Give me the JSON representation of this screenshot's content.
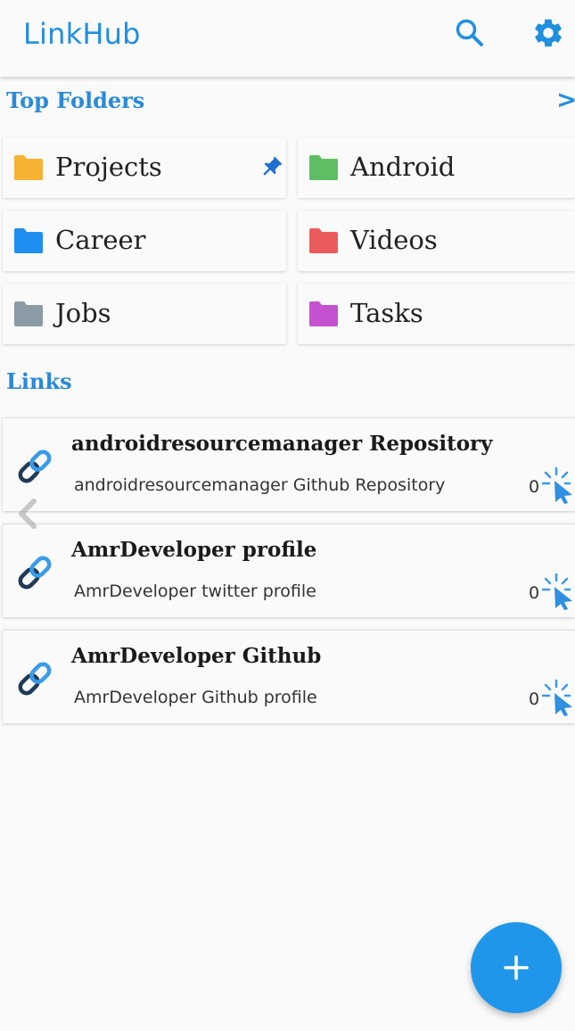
{
  "app_bar": {
    "title": "LinkHub",
    "icons": {
      "search": "search-icon",
      "settings": "gear-icon"
    }
  },
  "top_folders": {
    "title": "Top Folders",
    "more_icon": "chevron-right-icon",
    "items": [
      {
        "label": "Projects",
        "color": "#f5b233",
        "pinned": true
      },
      {
        "label": "Android",
        "color": "#5fbe63"
      },
      {
        "label": "Career",
        "color": "#1e8ff0"
      },
      {
        "label": "Videos",
        "color": "#ec5b5b"
      },
      {
        "label": "Jobs",
        "color": "#8a9ba6"
      },
      {
        "label": "Tasks",
        "color": "#c451cf"
      }
    ]
  },
  "links": {
    "title": "Links",
    "items": [
      {
        "title": "androidresourcemanager Repository",
        "description": "androidresourcemanager Github Repository",
        "clicks": "0"
      },
      {
        "title": "AmrDeveloper profile",
        "description": "AmrDeveloper twitter profile",
        "clicks": "0"
      },
      {
        "title": "AmrDeveloper Github",
        "description": "AmrDeveloper Github profile",
        "clicks": "0"
      }
    ]
  },
  "fab": {
    "icon": "plus-icon"
  },
  "colors": {
    "accent": "#1f8fe0",
    "fab": "#1f96ea"
  }
}
